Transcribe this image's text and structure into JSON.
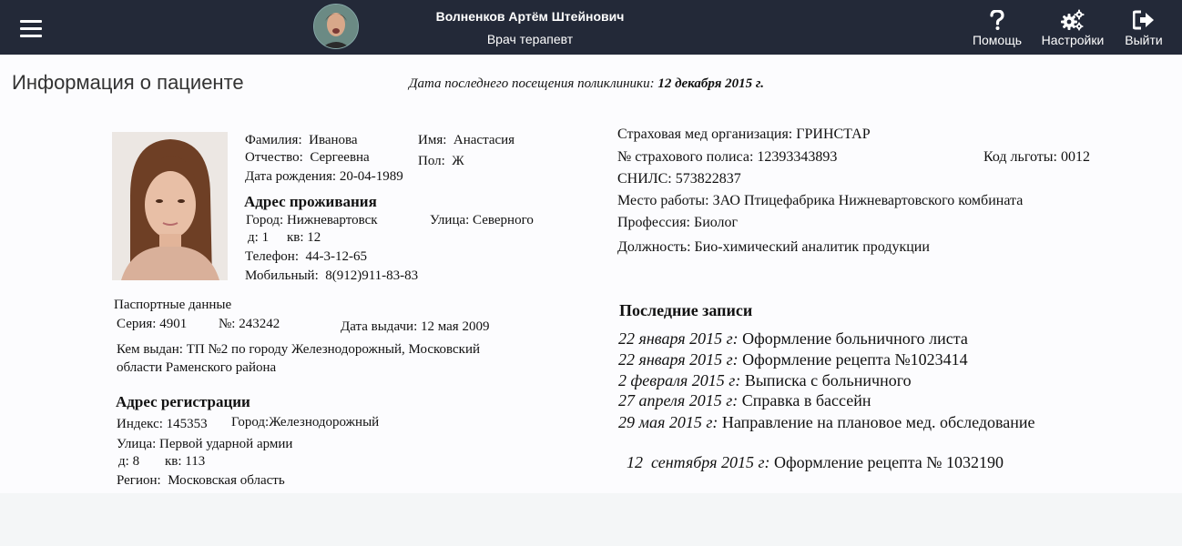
{
  "header": {
    "user_name": "Волненков Артём Штейнович",
    "user_role": "Врач терапевт",
    "help_label": "Помощь",
    "settings_label": "Настройки",
    "logout_label": "Выйти"
  },
  "page": {
    "title": "Информация о пациенте",
    "last_visit_label": "Дата последнего посещения поликлиники:",
    "last_visit_date": "12 декабря 2015 г."
  },
  "patient": {
    "surname_label": "Фамилия:",
    "surname": "Иванова",
    "name_label": "Имя:",
    "name": "Анастасия",
    "patronymic_label": "Отчество:",
    "patronymic": "Сергеевна",
    "sex_label": "Пол:",
    "sex": "Ж",
    "birth_label": "Дата рождения:",
    "birth": "20-04-1989",
    "residence_title": "Адрес проживания",
    "city_label": "Город:",
    "city": "Нижневартовск",
    "street_label": "Улица:",
    "street": "Северного",
    "house_label": "д:",
    "house": "1",
    "flat_label": "кв:",
    "flat": "12",
    "phone_label": "Телефон:",
    "phone": "44-3-12-65",
    "mobile_label": "Мобильный:",
    "mobile": "8(912)911-83-83"
  },
  "passport": {
    "title": "Паспортные данные",
    "series_label": "Серия:",
    "series": "4901",
    "number_label": "№:",
    "number": "243242",
    "issue_date_label": "Дата выдачи:",
    "issue_date": "12 мая 2009",
    "issued_by_label": "Кем выдан:",
    "issued_by_line1": "ТП №2 по городу Железнодорожный, Московский",
    "issued_by_line2": "области Раменского района"
  },
  "registration": {
    "title": "Адрес регистрации",
    "index_label": "Индекс:",
    "index": "145353",
    "city_label": "Город:",
    "city": "Железнодорожный",
    "street_label": "Улица:",
    "street": "Первой ударной армии",
    "house_label": "д:",
    "house": "8",
    "flat_label": "кв:",
    "flat": "113",
    "region_label": "Регион:",
    "region": "Московская область"
  },
  "insurance": {
    "org_label": "Страховая мед организация:",
    "org": "ГРИНСТАР",
    "policy_label": "№ страхового полиса:",
    "policy": "12393343893",
    "benefit_label": "Код льготы:",
    "benefit": "0012",
    "snils_label": "СНИЛС:",
    "snils": "573822837",
    "work_label": "Место работы:",
    "work": "ЗАО Птицефабрика Нижневартовского комбината",
    "profession_label": "Профессия:",
    "profession": "Биолог",
    "position_label": "Должность:",
    "position": "Био-химический аналитик продукции"
  },
  "records": {
    "title": "Последние записи",
    "items": [
      {
        "date": "22 января 2015 г:",
        "text": "Оформление больничного листа"
      },
      {
        "date": "22 января 2015 г:",
        "text": "Оформление рецепта №1023414"
      },
      {
        "date": "2 февраля 2015 г:",
        "text": "Выписка с больничного"
      },
      {
        "date": "27 апреля 2015 г:",
        "text": "Справка в бассейн"
      },
      {
        "date": "29 мая 2015 г:",
        "text": "Направление на плановое мед. обследование"
      },
      {
        "date": "12  сентября 2015 г:",
        "text": "Оформление рецепта № 1032190"
      }
    ]
  }
}
